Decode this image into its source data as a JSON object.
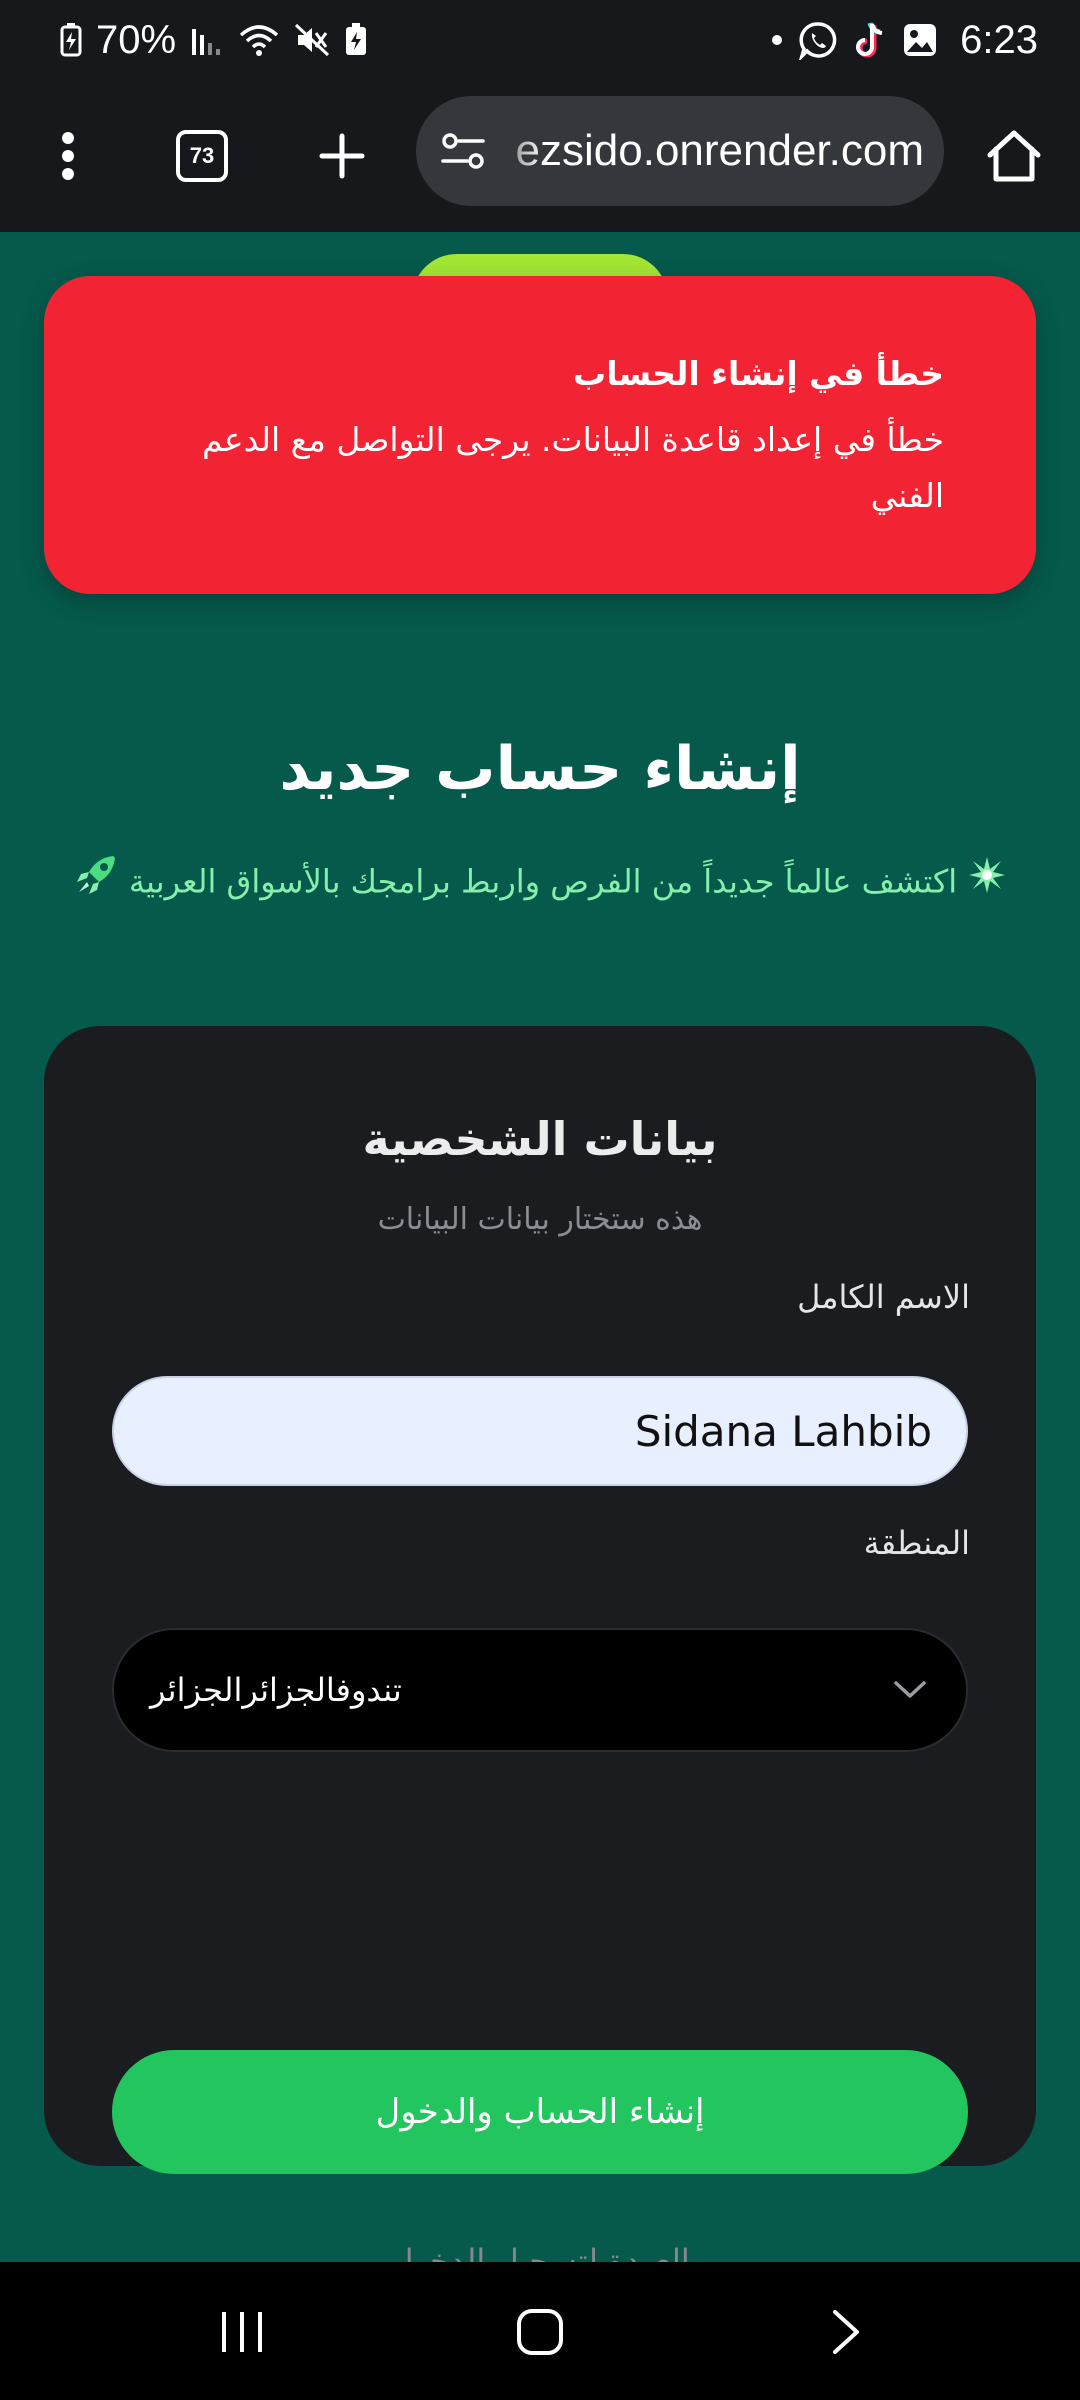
{
  "status_bar": {
    "battery_percent": "70%",
    "time": "6:23",
    "icons": [
      "battery-charging-icon",
      "signal-icon",
      "wifi-icon",
      "mute-vibrate-icon",
      "battery-saver-icon",
      "dot-icon",
      "whatsapp-icon",
      "tiktok-icon",
      "gallery-icon"
    ]
  },
  "browser": {
    "tab_count": "73",
    "url": "ezsido.onrender.com",
    "icons": [
      "menu-dots-icon",
      "new-tab-icon",
      "site-settings-icon",
      "home-icon"
    ]
  },
  "error_toast": {
    "title": "خطأ في إنشاء الحساب",
    "message": "خطأ في إعداد قاعدة البيانات. يرجى التواصل مع الدعم الفني",
    "color": "#f22434"
  },
  "header": {
    "title": "إنشاء حساب جديد",
    "subtitle": "اكتشف عالماً جديداً من الفرص واربط برامجك بالأسواق العربية",
    "leading_emoji": "sparkle-icon",
    "trailing_emoji": "rocket-icon"
  },
  "form": {
    "title": "بيانات الشخصية",
    "subtitle": "هذه ستختار بيانات البيانات",
    "name_label": "الاسم الكامل",
    "name_value": "Sidana Lahbib",
    "region_label": "المنطقة",
    "region_value": "تندوفالجزائرالجزائر",
    "submit_label": "إنشاء الحساب والدخول",
    "back_link": "العودة لتسجيل الدخول"
  },
  "colors": {
    "page_bg": "#055a4c",
    "card_bg": "#1b1c20",
    "accent_green": "#22c55e",
    "subtitle_green": "#86efac",
    "error_red": "#f22434"
  },
  "nav_bar": {
    "icons": [
      "recent-apps-icon",
      "home-button-icon",
      "back-icon"
    ]
  }
}
